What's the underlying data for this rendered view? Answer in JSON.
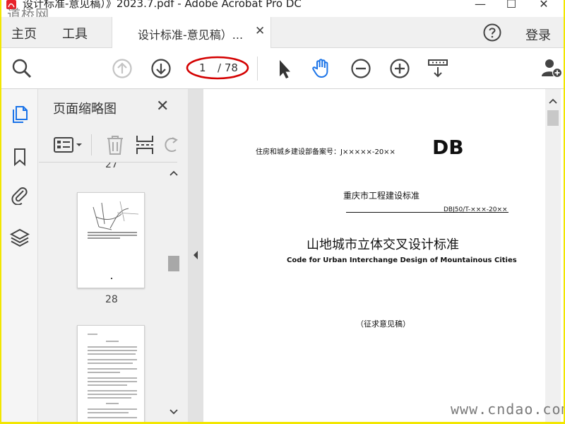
{
  "window": {
    "title": "设计标准-意见稿）》2023.7.pdf - Adobe Acrobat Pro DC",
    "minimize": "—",
    "restore": "☐",
    "close": "✕"
  },
  "watermarks": {
    "top_left": "道桥网",
    "bottom_right": "www.cndao.com"
  },
  "menubar": {
    "home": "主页",
    "tools": "工具",
    "tab_title": "设计标准-意见稿）...",
    "tab_close": "✕",
    "login": "登录"
  },
  "toolbar": {
    "page_current": "1",
    "page_total": "/ 78",
    "highlight_color": "#d40000",
    "active_tool_color": "#1a73e8"
  },
  "thumbnails": {
    "title": "页面缩略图",
    "close": "✕",
    "partial_label": "27",
    "pages": [
      {
        "label": "28"
      }
    ]
  },
  "document": {
    "record_no": "住房和城乡建设部备案号：J×××××-20××",
    "db": "DB",
    "standard_authority": "重庆市工程建设标准",
    "standard_code": "DBJ50/T-×××-20××",
    "title_cn": "山地城市立体交叉设计标准",
    "title_en": "Code for Urban Interchange Design of Mountainous Cities",
    "draft_note": "（征求意见稿）"
  }
}
